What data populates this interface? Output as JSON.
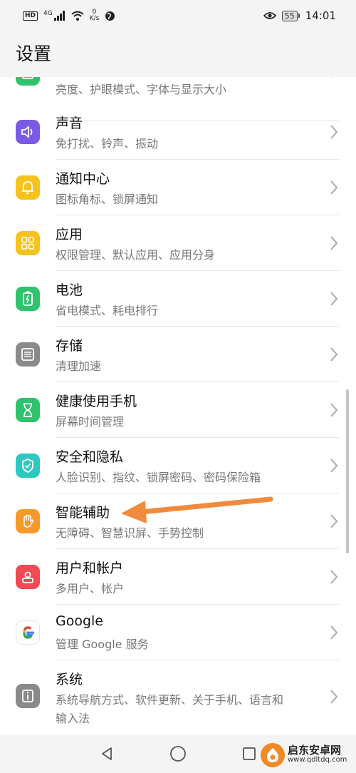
{
  "status_bar": {
    "network_badge": "HD",
    "network_type": "4G",
    "speed_value": "0",
    "speed_unit": "K/s",
    "battery": "55",
    "time": "14:01"
  },
  "header": {
    "title": "设置"
  },
  "list": {
    "items": [
      {
        "title": "",
        "subtitle": "亮度、护眼模式、字体与显示大小",
        "icon": "display-icon",
        "color": "#2fc36d"
      },
      {
        "title": "声音",
        "subtitle": "免打扰、铃声、振动",
        "icon": "speaker-icon",
        "color": "#7a5be6"
      },
      {
        "title": "通知中心",
        "subtitle": "图标角标、锁屏通知",
        "icon": "bell-icon",
        "color": "#f5c320"
      },
      {
        "title": "应用",
        "subtitle": "权限管理、默认应用、应用分身",
        "icon": "grid-icon",
        "color": "#f5c320"
      },
      {
        "title": "电池",
        "subtitle": "省电模式、耗电排行",
        "icon": "battery-icon",
        "color": "#2fc36d"
      },
      {
        "title": "存储",
        "subtitle": "清理加速",
        "icon": "storage-icon",
        "color": "#8a8a8a"
      },
      {
        "title": "健康使用手机",
        "subtitle": "屏幕时间管理",
        "icon": "hourglass-icon",
        "color": "#2fc36d"
      },
      {
        "title": "安全和隐私",
        "subtitle": "人脸识别、指纹、锁屏密码、密码保险箱",
        "icon": "shield-icon",
        "color": "#2ec8c0"
      },
      {
        "title": "智能辅助",
        "subtitle": "无障碍、智慧识屏、手势控制",
        "icon": "hand-icon",
        "color": "#f59a2a"
      },
      {
        "title": "用户和帐户",
        "subtitle": "多用户、帐户",
        "icon": "user-icon",
        "color": "#ef4a56"
      },
      {
        "title": "Google",
        "subtitle": "管理 Google 服务",
        "icon": "google-icon",
        "color": "#ffffff"
      },
      {
        "title": "系统",
        "subtitle": "系统导航方式、软件更新、关于手机、语言和",
        "subtitle2": "输入法",
        "icon": "info-icon",
        "color": "#8a8a8a"
      }
    ]
  },
  "watermark": {
    "name": "启东安卓网",
    "url": "www.qdltdq.com"
  },
  "colors": {
    "annotation_arrow": "#f08a3c",
    "accent_orange": "#f08a24"
  }
}
